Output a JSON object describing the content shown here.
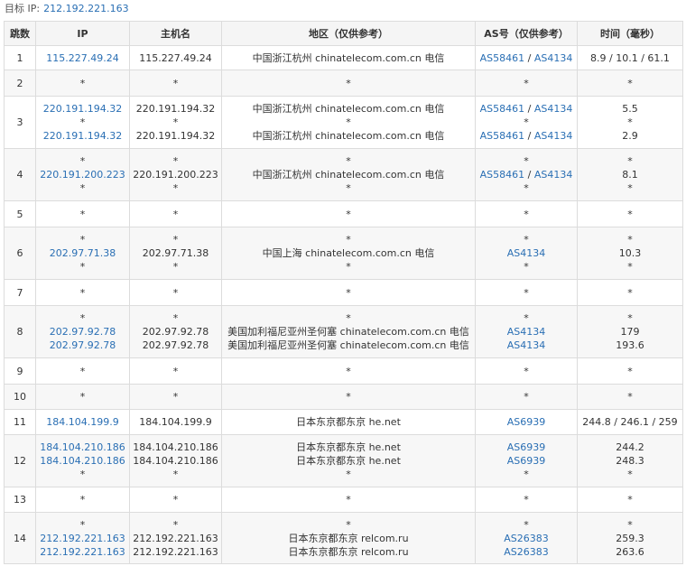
{
  "target": {
    "label": "目标 IP:",
    "ip": "212.192.221.163"
  },
  "headers": [
    "跳数",
    "IP",
    "主机名",
    "地区（仅供参考）",
    "AS号（仅供参考）",
    "时间（毫秒）"
  ],
  "rows": [
    {
      "hop": "1",
      "h": 27,
      "ip": [
        "115.227.49.24"
      ],
      "host": [
        "115.227.49.24"
      ],
      "region": [
        "中国浙江杭州 chinatelecom.com.cn 电信"
      ],
      "as": [
        [
          "AS58461",
          "AS4134"
        ]
      ],
      "time": [
        "8.9 / 10.1 / 61.1"
      ]
    },
    {
      "hop": "2",
      "h": 29,
      "ip": [
        "*"
      ],
      "host": [
        "*"
      ],
      "region": [
        "*"
      ],
      "as": [
        [
          "*"
        ]
      ],
      "time": [
        "*"
      ]
    },
    {
      "hop": "3",
      "h": 58,
      "ip": [
        "220.191.194.32",
        "*",
        "220.191.194.32"
      ],
      "host": [
        "220.191.194.32",
        "*",
        "220.191.194.32"
      ],
      "region": [
        "中国浙江杭州 chinatelecom.com.cn 电信",
        "*",
        "中国浙江杭州 chinatelecom.com.cn 电信"
      ],
      "as": [
        [
          "AS58461",
          "AS4134"
        ],
        [
          "*"
        ],
        [
          "AS58461",
          "AS4134"
        ]
      ],
      "time": [
        "5.5",
        "*",
        "2.9"
      ]
    },
    {
      "hop": "4",
      "h": 58,
      "ip": [
        "*",
        "220.191.200.223",
        "*"
      ],
      "host": [
        "*",
        "220.191.200.223",
        "*"
      ],
      "region": [
        "*",
        "中国浙江杭州 chinatelecom.com.cn 电信",
        "*"
      ],
      "as": [
        [
          "*"
        ],
        [
          "AS58461",
          "AS4134"
        ],
        [
          "*"
        ]
      ],
      "time": [
        "*",
        "8.1",
        "*"
      ]
    },
    {
      "hop": "5",
      "h": 29,
      "ip": [
        "*"
      ],
      "host": [
        "*"
      ],
      "region": [
        "*"
      ],
      "as": [
        [
          "*"
        ]
      ],
      "time": [
        "*"
      ]
    },
    {
      "hop": "6",
      "h": 58,
      "ip": [
        "*",
        "202.97.71.38",
        "*"
      ],
      "host": [
        "*",
        "202.97.71.38",
        "*"
      ],
      "region": [
        "*",
        "中国上海 chinatelecom.com.cn 电信",
        "*"
      ],
      "as": [
        [
          "*"
        ],
        [
          "AS4134"
        ],
        [
          "*"
        ]
      ],
      "time": [
        "*",
        "10.3",
        "*"
      ]
    },
    {
      "hop": "7",
      "h": 29,
      "ip": [
        "*"
      ],
      "host": [
        "*"
      ],
      "region": [
        "*"
      ],
      "as": [
        [
          "*"
        ]
      ],
      "time": [
        "*"
      ]
    },
    {
      "hop": "8",
      "h": 58,
      "ip": [
        "*",
        "202.97.92.78",
        "202.97.92.78"
      ],
      "host": [
        "*",
        "202.97.92.78",
        "202.97.92.78"
      ],
      "region": [
        "*",
        "美国加利福尼亚州圣何塞 chinatelecom.com.cn 电信",
        "美国加利福尼亚州圣何塞 chinatelecom.com.cn 电信"
      ],
      "as": [
        [
          "*"
        ],
        [
          "AS4134"
        ],
        [
          "AS4134"
        ]
      ],
      "time": [
        "*",
        "179",
        "193.6"
      ]
    },
    {
      "hop": "9",
      "h": 29,
      "ip": [
        "*"
      ],
      "host": [
        "*"
      ],
      "region": [
        "*"
      ],
      "as": [
        [
          "*"
        ]
      ],
      "time": [
        "*"
      ]
    },
    {
      "hop": "10",
      "h": 28,
      "ip": [
        "*"
      ],
      "host": [
        "*"
      ],
      "region": [
        "*"
      ],
      "as": [
        [
          "*"
        ]
      ],
      "time": [
        "*"
      ]
    },
    {
      "hop": "11",
      "h": 28,
      "ip": [
        "184.104.199.9"
      ],
      "host": [
        "184.104.199.9"
      ],
      "region": [
        "日本东京都东京 he.net"
      ],
      "as": [
        [
          "AS6939"
        ]
      ],
      "time": [
        "244.8 / 246.1 / 259"
      ]
    },
    {
      "hop": "12",
      "h": 58,
      "ip": [
        "184.104.210.186",
        "184.104.210.186",
        "*"
      ],
      "host": [
        "184.104.210.186",
        "184.104.210.186",
        "*"
      ],
      "region": [
        "日本东京都东京 he.net",
        "日本东京都东京 he.net",
        "*"
      ],
      "as": [
        [
          "AS6939"
        ],
        [
          "AS6939"
        ],
        [
          "*"
        ]
      ],
      "time": [
        "244.2",
        "248.3",
        "*"
      ]
    },
    {
      "hop": "13",
      "h": 28,
      "ip": [
        "*"
      ],
      "host": [
        "*"
      ],
      "region": [
        "*"
      ],
      "as": [
        [
          "*"
        ]
      ],
      "time": [
        "*"
      ]
    },
    {
      "hop": "14",
      "h": 57,
      "ip": [
        "*",
        "212.192.221.163",
        "212.192.221.163"
      ],
      "host": [
        "*",
        "212.192.221.163",
        "212.192.221.163"
      ],
      "region": [
        "*",
        "日本东京都东京 relcom.ru",
        "日本东京都东京 relcom.ru"
      ],
      "as": [
        [
          "*"
        ],
        [
          "AS26383"
        ],
        [
          "AS26383"
        ]
      ],
      "time": [
        "*",
        "259.3",
        "263.6"
      ]
    }
  ]
}
